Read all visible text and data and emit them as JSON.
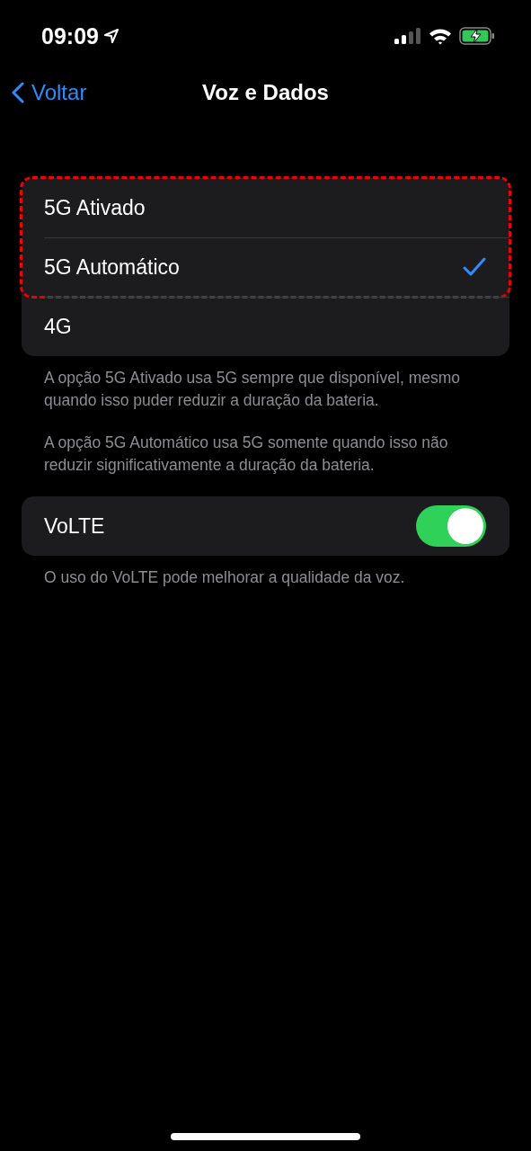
{
  "status_bar": {
    "time": "09:09",
    "location_active": true,
    "charging": true
  },
  "nav": {
    "back": "Voltar",
    "title": "Voz e Dados"
  },
  "options": [
    {
      "label": "5G Ativado",
      "selected": false,
      "highlighted": true
    },
    {
      "label": "5G Automático",
      "selected": true,
      "highlighted": true
    },
    {
      "label": "4G",
      "selected": false,
      "highlighted": false
    }
  ],
  "options_notes": [
    "A opção 5G Ativado usa 5G sempre que disponível, mesmo quando isso puder reduzir a duração da bateria.",
    "A opção 5G Automático usa 5G somente quando isso não reduzir significativamente a duração da bateria."
  ],
  "volte": {
    "label": "VoLTE",
    "on": true,
    "note": "O uso do VoLTE pode melhorar a qualidade da voz."
  }
}
